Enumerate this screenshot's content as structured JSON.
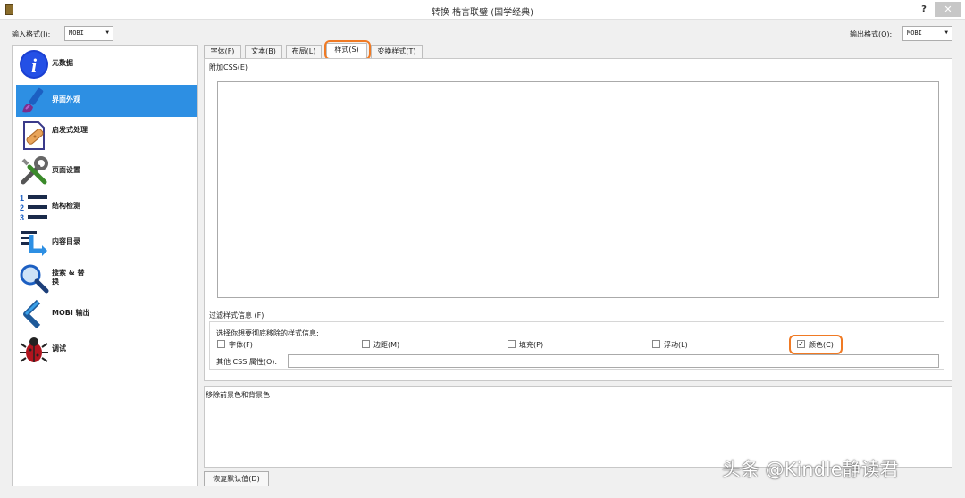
{
  "window": {
    "title": "转换 梏言联璧 (国学经典)",
    "help": "?",
    "close": "✕"
  },
  "input_format": {
    "label": "输入格式(I):",
    "value": "MOBI"
  },
  "output_format": {
    "label": "输出格式(O):",
    "value": "MOBI"
  },
  "sidebar": {
    "active_index": 1,
    "accent_color": "#2d8fe3",
    "items": [
      {
        "label": "元数据",
        "icon": "info-icon"
      },
      {
        "label": "界面外观",
        "icon": "paintbrush-icon"
      },
      {
        "label": "启发式处理",
        "icon": "document-bandage-icon"
      },
      {
        "label": "页面设置",
        "icon": "tools-icon"
      },
      {
        "label": "结构检测",
        "icon": "numbered-list-icon"
      },
      {
        "label": "内容目录",
        "icon": "toc-icon"
      },
      {
        "label": "搜索 & 替换",
        "icon": "magnifier-icon"
      },
      {
        "label": "MOBI 输出",
        "icon": "chevron-left-icon"
      },
      {
        "label": "调试",
        "icon": "bug-icon"
      }
    ]
  },
  "tabs": {
    "items": [
      "字体(F)",
      "文本(B)",
      "布局(L)",
      "样式(S)",
      "变换样式(T)"
    ],
    "active_index": 3
  },
  "styling": {
    "extra_css_label": "附加CSS(E)",
    "extra_css_value": "",
    "filter_label": "过滤样式信息 (F)",
    "filter_sublabel": "选择你想要彻底移除的样式信息:",
    "checkboxes": [
      {
        "label": "字体(F)",
        "checked": false
      },
      {
        "label": "边距(M)",
        "checked": false
      },
      {
        "label": "填充(P)",
        "checked": false
      },
      {
        "label": "浮动(L)",
        "checked": false
      },
      {
        "label": "颜色(C)",
        "checked": true,
        "check_mark": "✓"
      }
    ],
    "other_css_label": "其他 CSS 属性(O):",
    "other_css_value": ""
  },
  "help_text": "移除前景色和背景色",
  "restore_button": "恢复默认值(D)",
  "watermark": "头条 @Kindle静读君",
  "highlight_color": "#f07a24"
}
